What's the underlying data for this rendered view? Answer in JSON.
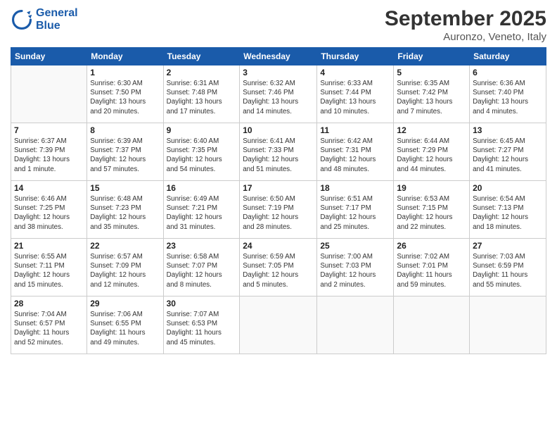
{
  "header": {
    "logo_line1": "General",
    "logo_line2": "Blue",
    "month": "September 2025",
    "location": "Auronzo, Veneto, Italy"
  },
  "days_of_week": [
    "Sunday",
    "Monday",
    "Tuesday",
    "Wednesday",
    "Thursday",
    "Friday",
    "Saturday"
  ],
  "weeks": [
    [
      {
        "day": "",
        "info": ""
      },
      {
        "day": "1",
        "info": "Sunrise: 6:30 AM\nSunset: 7:50 PM\nDaylight: 13 hours\nand 20 minutes."
      },
      {
        "day": "2",
        "info": "Sunrise: 6:31 AM\nSunset: 7:48 PM\nDaylight: 13 hours\nand 17 minutes."
      },
      {
        "day": "3",
        "info": "Sunrise: 6:32 AM\nSunset: 7:46 PM\nDaylight: 13 hours\nand 14 minutes."
      },
      {
        "day": "4",
        "info": "Sunrise: 6:33 AM\nSunset: 7:44 PM\nDaylight: 13 hours\nand 10 minutes."
      },
      {
        "day": "5",
        "info": "Sunrise: 6:35 AM\nSunset: 7:42 PM\nDaylight: 13 hours\nand 7 minutes."
      },
      {
        "day": "6",
        "info": "Sunrise: 6:36 AM\nSunset: 7:40 PM\nDaylight: 13 hours\nand 4 minutes."
      }
    ],
    [
      {
        "day": "7",
        "info": "Sunrise: 6:37 AM\nSunset: 7:39 PM\nDaylight: 13 hours\nand 1 minute."
      },
      {
        "day": "8",
        "info": "Sunrise: 6:39 AM\nSunset: 7:37 PM\nDaylight: 12 hours\nand 57 minutes."
      },
      {
        "day": "9",
        "info": "Sunrise: 6:40 AM\nSunset: 7:35 PM\nDaylight: 12 hours\nand 54 minutes."
      },
      {
        "day": "10",
        "info": "Sunrise: 6:41 AM\nSunset: 7:33 PM\nDaylight: 12 hours\nand 51 minutes."
      },
      {
        "day": "11",
        "info": "Sunrise: 6:42 AM\nSunset: 7:31 PM\nDaylight: 12 hours\nand 48 minutes."
      },
      {
        "day": "12",
        "info": "Sunrise: 6:44 AM\nSunset: 7:29 PM\nDaylight: 12 hours\nand 44 minutes."
      },
      {
        "day": "13",
        "info": "Sunrise: 6:45 AM\nSunset: 7:27 PM\nDaylight: 12 hours\nand 41 minutes."
      }
    ],
    [
      {
        "day": "14",
        "info": "Sunrise: 6:46 AM\nSunset: 7:25 PM\nDaylight: 12 hours\nand 38 minutes."
      },
      {
        "day": "15",
        "info": "Sunrise: 6:48 AM\nSunset: 7:23 PM\nDaylight: 12 hours\nand 35 minutes."
      },
      {
        "day": "16",
        "info": "Sunrise: 6:49 AM\nSunset: 7:21 PM\nDaylight: 12 hours\nand 31 minutes."
      },
      {
        "day": "17",
        "info": "Sunrise: 6:50 AM\nSunset: 7:19 PM\nDaylight: 12 hours\nand 28 minutes."
      },
      {
        "day": "18",
        "info": "Sunrise: 6:51 AM\nSunset: 7:17 PM\nDaylight: 12 hours\nand 25 minutes."
      },
      {
        "day": "19",
        "info": "Sunrise: 6:53 AM\nSunset: 7:15 PM\nDaylight: 12 hours\nand 22 minutes."
      },
      {
        "day": "20",
        "info": "Sunrise: 6:54 AM\nSunset: 7:13 PM\nDaylight: 12 hours\nand 18 minutes."
      }
    ],
    [
      {
        "day": "21",
        "info": "Sunrise: 6:55 AM\nSunset: 7:11 PM\nDaylight: 12 hours\nand 15 minutes."
      },
      {
        "day": "22",
        "info": "Sunrise: 6:57 AM\nSunset: 7:09 PM\nDaylight: 12 hours\nand 12 minutes."
      },
      {
        "day": "23",
        "info": "Sunrise: 6:58 AM\nSunset: 7:07 PM\nDaylight: 12 hours\nand 8 minutes."
      },
      {
        "day": "24",
        "info": "Sunrise: 6:59 AM\nSunset: 7:05 PM\nDaylight: 12 hours\nand 5 minutes."
      },
      {
        "day": "25",
        "info": "Sunrise: 7:00 AM\nSunset: 7:03 PM\nDaylight: 12 hours\nand 2 minutes."
      },
      {
        "day": "26",
        "info": "Sunrise: 7:02 AM\nSunset: 7:01 PM\nDaylight: 11 hours\nand 59 minutes."
      },
      {
        "day": "27",
        "info": "Sunrise: 7:03 AM\nSunset: 6:59 PM\nDaylight: 11 hours\nand 55 minutes."
      }
    ],
    [
      {
        "day": "28",
        "info": "Sunrise: 7:04 AM\nSunset: 6:57 PM\nDaylight: 11 hours\nand 52 minutes."
      },
      {
        "day": "29",
        "info": "Sunrise: 7:06 AM\nSunset: 6:55 PM\nDaylight: 11 hours\nand 49 minutes."
      },
      {
        "day": "30",
        "info": "Sunrise: 7:07 AM\nSunset: 6:53 PM\nDaylight: 11 hours\nand 45 minutes."
      },
      {
        "day": "",
        "info": ""
      },
      {
        "day": "",
        "info": ""
      },
      {
        "day": "",
        "info": ""
      },
      {
        "day": "",
        "info": ""
      }
    ]
  ]
}
